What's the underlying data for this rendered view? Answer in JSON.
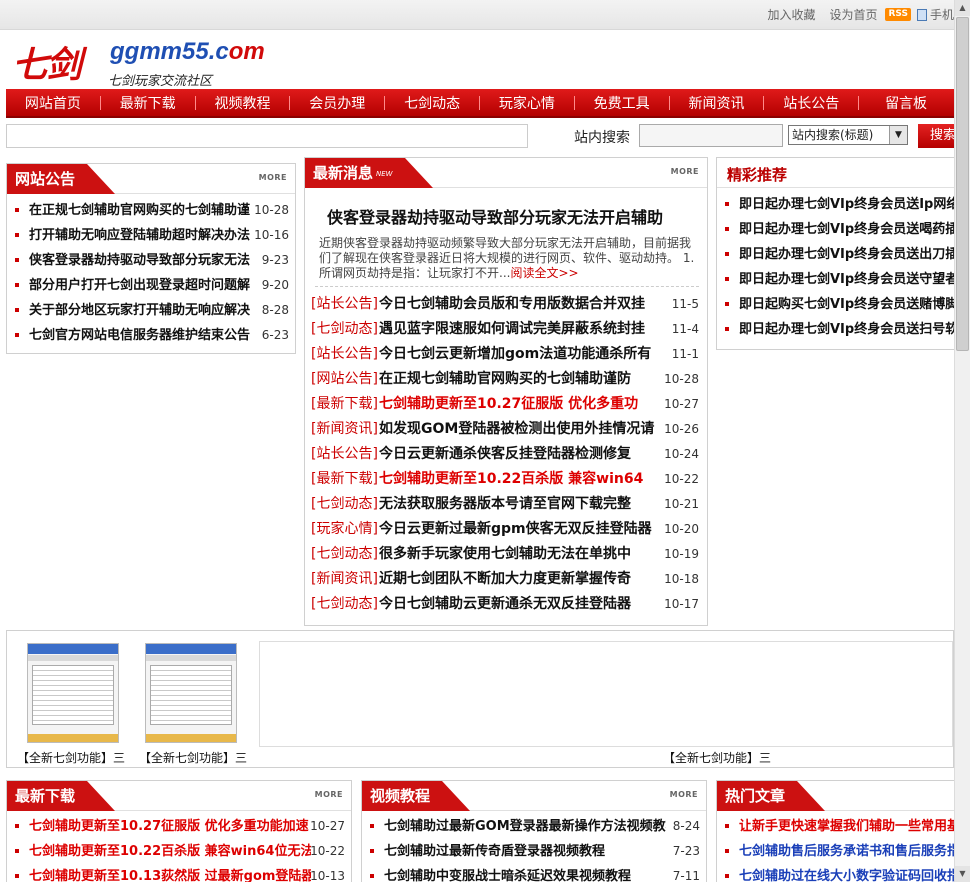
{
  "top_links": {
    "bookmark": "加入收藏",
    "homepage": "设为首页",
    "rss": "RSS",
    "mobile": "手机"
  },
  "logo": {
    "name_cn": "七剑",
    "domain_a": "ggmm55.c",
    "domain_b": "om",
    "subtitle": "七剑玩家交流社区"
  },
  "nav": [
    "网站首页",
    "最新下载",
    "视频教程",
    "会员办理",
    "七剑动态",
    "玩家心情",
    "免费工具",
    "新闻资讯",
    "站长公告",
    "留言板"
  ],
  "search": {
    "label": "站内搜索",
    "select_value": "站内搜索(标题)",
    "button": "搜索"
  },
  "announcements": {
    "title": "网站公告",
    "more": "MORE",
    "items": [
      {
        "title": "在正规七剑辅助官网购买的七剑辅助谨",
        "date": "10-28"
      },
      {
        "title": "打开辅助无响应登陆辅助超时解决办法",
        "date": "10-16"
      },
      {
        "title": "侠客登录器劫持驱动导致部分玩家无法",
        "date": "9-23"
      },
      {
        "title": "部分用户打开七剑出现登录超时问题解",
        "date": "9-20"
      },
      {
        "title": "关于部分地区玩家打开辅助无响应解决",
        "date": "8-28"
      },
      {
        "title": "七剑官方网站电信服务器维护结束公告",
        "date": "6-23"
      }
    ]
  },
  "latest": {
    "title": "最新消息",
    "badge": "NEW",
    "more": "MORE",
    "feature_title": "侠客登录器劫持驱动导致部分玩家无法开启辅助",
    "feature_desc": "近期侠客登录器劫持驱动频繁导致大部分玩家无法开启辅助，目前据我们了解现在侠客登录器近日将大规模的进行网页、软件、驱动劫持。 1.所谓网页劫持是指：让玩家打不开...",
    "read_more": "阅读全文>>",
    "items": [
      {
        "cat": "[站长公告]",
        "title": "今日七剑辅助会员版和专用版数据合并双挂",
        "date": "11-5",
        "red": false
      },
      {
        "cat": "[七剑动态]",
        "title": "遇见蓝字限速服如何调试完美屏蔽系统封挂",
        "date": "11-4",
        "red": false
      },
      {
        "cat": "[站长公告]",
        "title": "今日七剑云更新增加gom法道功能通杀所有",
        "date": "11-1",
        "red": false
      },
      {
        "cat": "[网站公告]",
        "title": "在正规七剑辅助官网购买的七剑辅助谨防",
        "date": "10-28",
        "red": false
      },
      {
        "cat": "[最新下载]",
        "title": "七剑辅助更新至10.27征服版 优化多重功",
        "date": "10-27",
        "red": true
      },
      {
        "cat": "[新闻资讯]",
        "title": "如发现GOM登陆器被检测出使用外挂情况请",
        "date": "10-26",
        "red": false
      },
      {
        "cat": "[站长公告]",
        "title": "今日云更新通杀侠客反挂登陆器检测修复",
        "date": "10-24",
        "red": false
      },
      {
        "cat": "[最新下载]",
        "title": "七剑辅助更新至10.22百杀版 兼容win64",
        "date": "10-22",
        "red": true
      },
      {
        "cat": "[七剑动态]",
        "title": "无法获取服务器版本号请至官网下载完整",
        "date": "10-21",
        "red": false
      },
      {
        "cat": "[玩家心情]",
        "title": "今日云更新过最新gpm侠客无双反挂登陆器",
        "date": "10-20",
        "red": false
      },
      {
        "cat": "[七剑动态]",
        "title": "很多新手玩家使用七剑辅助无法在单挑中",
        "date": "10-19",
        "red": false
      },
      {
        "cat": "[新闻资讯]",
        "title": "近期七剑团队不断加大力度更新掌握传奇",
        "date": "10-18",
        "red": false
      },
      {
        "cat": "[七剑动态]",
        "title": "今日七剑辅助云更新通杀无双反挂登陆器",
        "date": "10-17",
        "red": false
      }
    ]
  },
  "recommend": {
    "title": "精彩推荐",
    "items": [
      "即日起办理七剑VIp终身会员送Ip网络",
      "即日起办理七剑VIp终身会员送喝药插",
      "即日起办理七剑VIp终身会员送出刀插",
      "即日起办理七剑VIp终身会员送守望者",
      "即日起购买七剑VIp终身会员送赌博脚",
      "即日起办理七剑VIp终身会员送扫号软"
    ]
  },
  "pictures": {
    "captions": [
      "【全新七剑功能】三",
      "【全新七剑功能】三",
      "【全新七剑功能】三"
    ]
  },
  "downloads": {
    "title": "最新下载",
    "more": "MORE",
    "items": [
      {
        "title": "七剑辅助更新至10.27征服版 优化多重功能加速",
        "date": "10-27"
      },
      {
        "title": "七剑辅助更新至10.22百杀版 兼容win64位无法",
        "date": "10-22"
      },
      {
        "title": "七剑辅助更新至10.13荻然版 过最新gom登陆器",
        "date": "10-13"
      }
    ]
  },
  "videos": {
    "title": "视频教程",
    "more": "MORE",
    "items": [
      {
        "title": "七剑辅助过最新GOM登录器最新操作方法视频教程",
        "date": "8-24"
      },
      {
        "title": "七剑辅助过最新传奇盾登录器视频教程",
        "date": "7-23"
      },
      {
        "title": "七剑辅助中变服战士暗杀延迟效果视频教程",
        "date": "7-11"
      }
    ]
  },
  "hot": {
    "title": "热门文章",
    "items": [
      {
        "title": "让新手更快速掌握我们辅助一些常用基",
        "color": "red"
      },
      {
        "title": "七剑辅助售后服务承诺书和售后服务指",
        "color": "blue"
      },
      {
        "title": "七剑辅助过在线大小数字验证码回收指",
        "color": "blue"
      }
    ]
  }
}
